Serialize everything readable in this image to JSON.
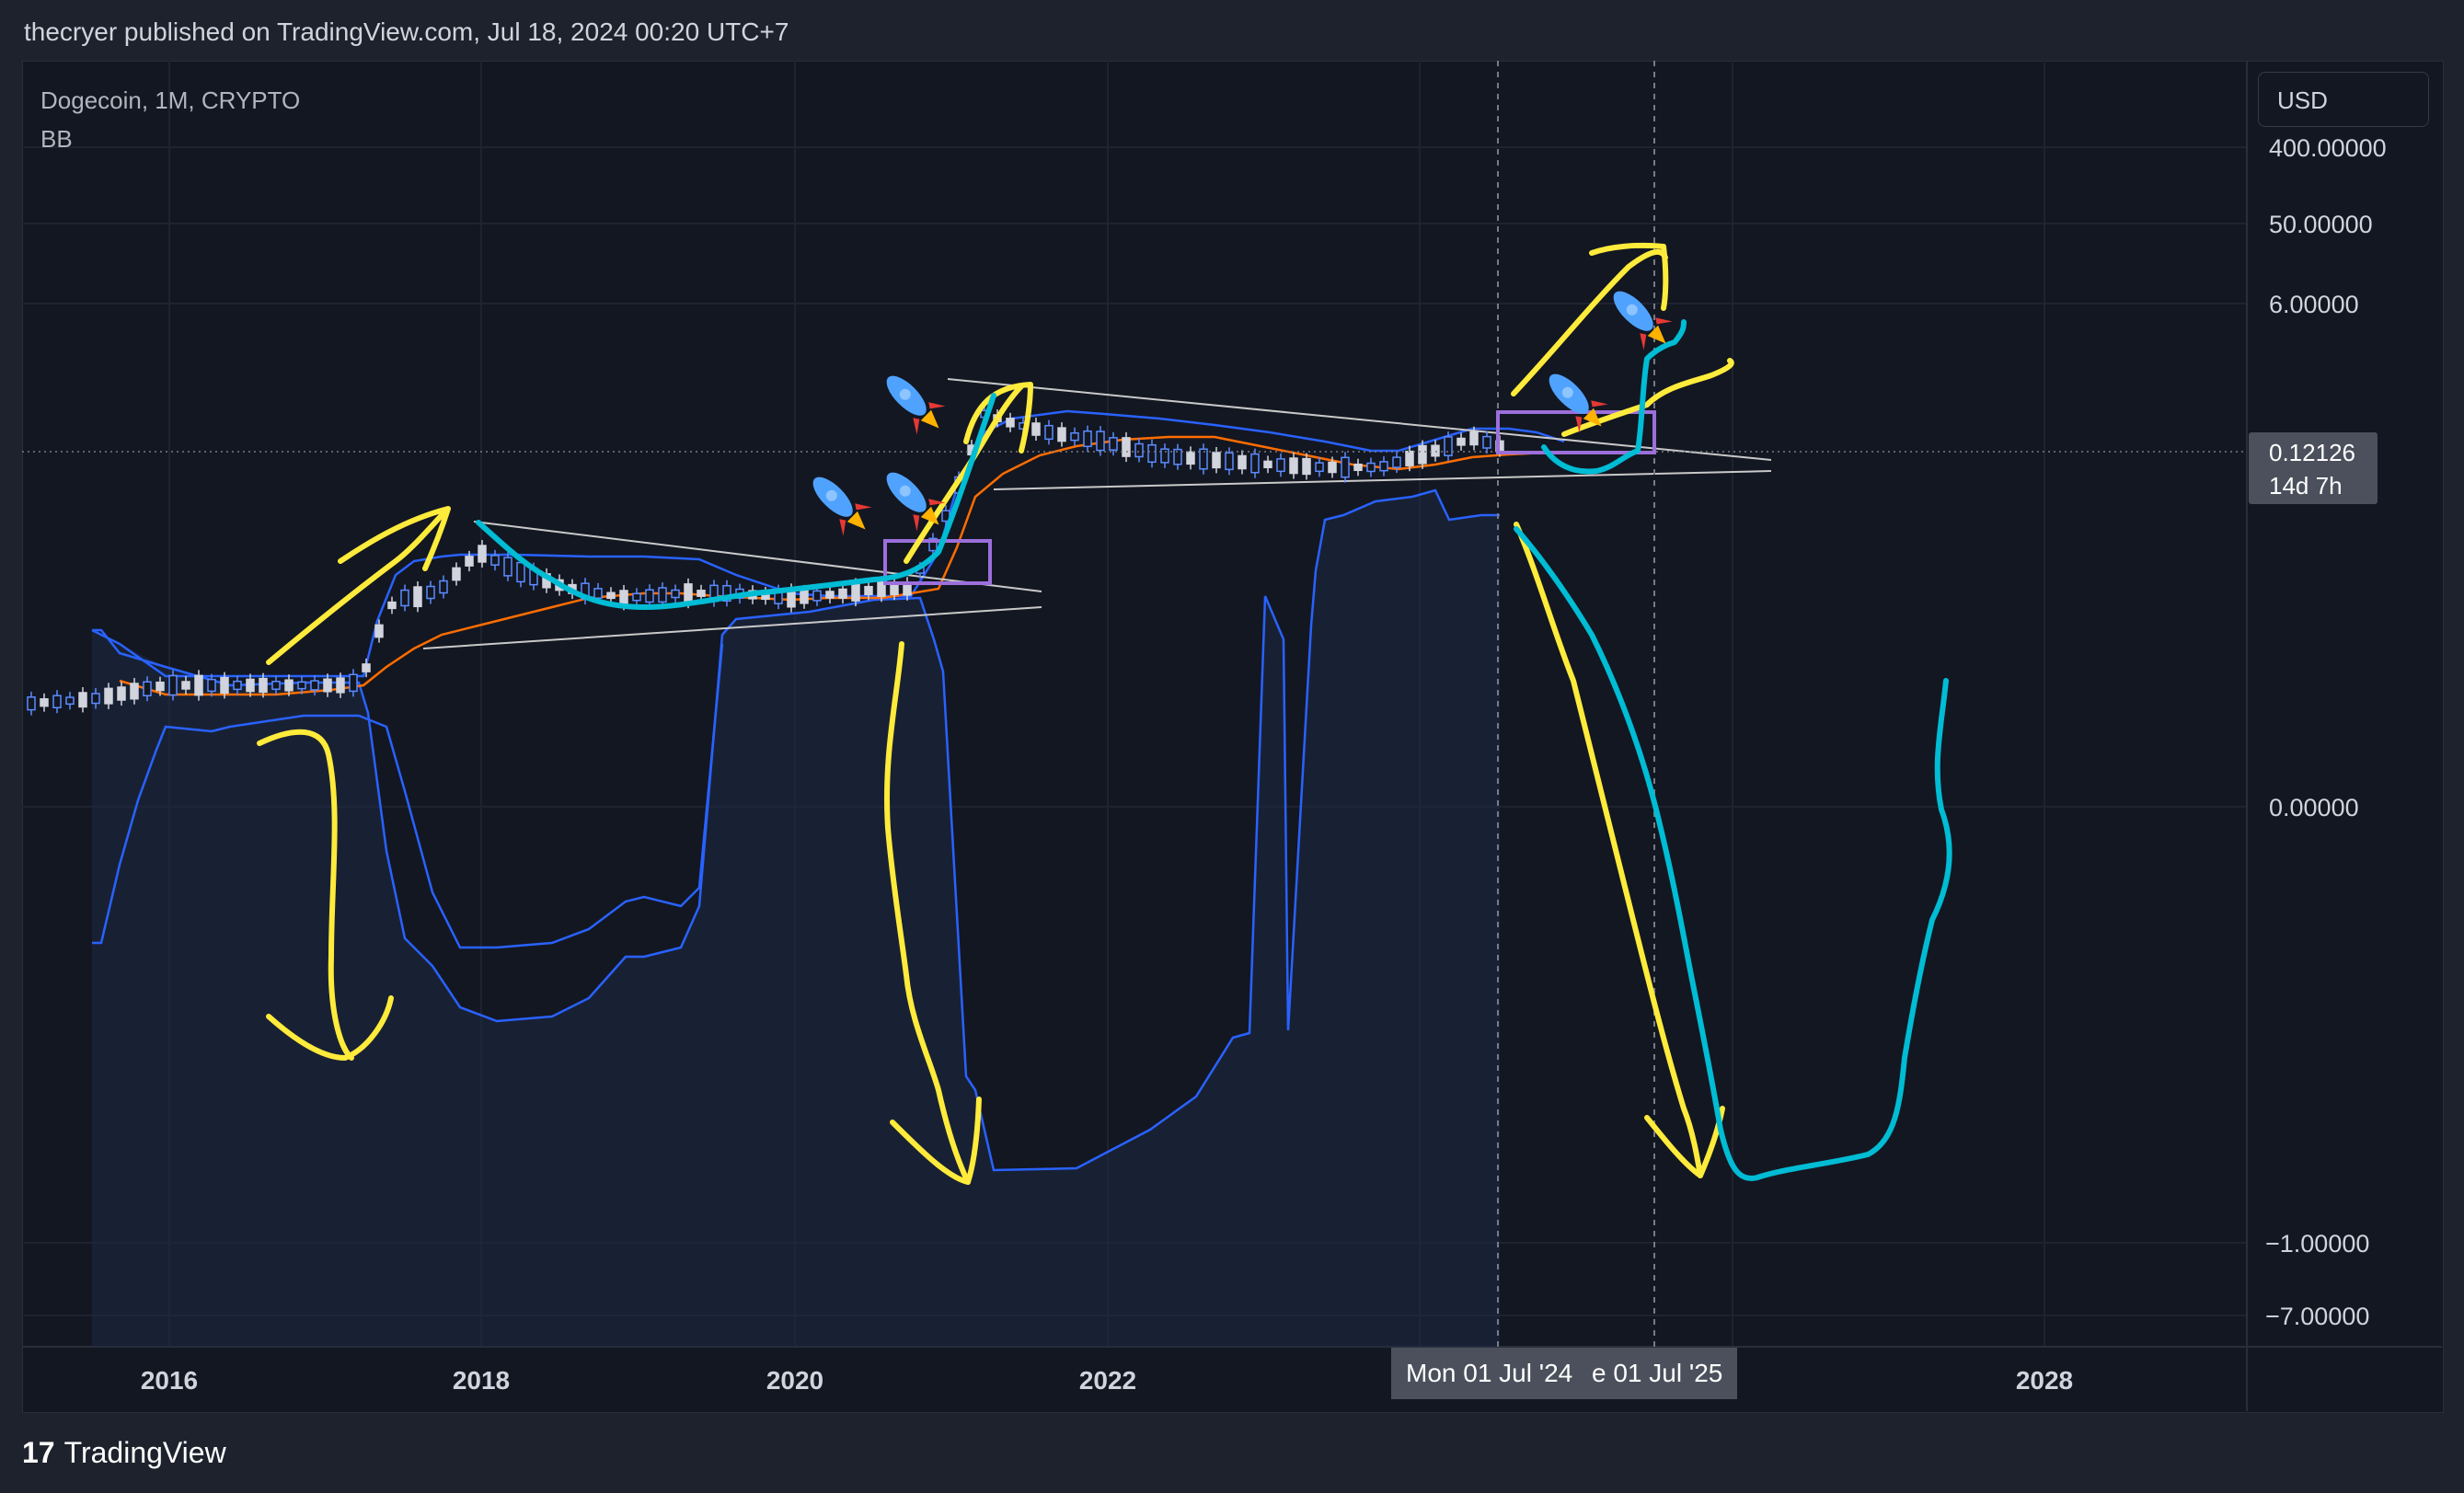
{
  "header": {
    "published": "thecryer published on TradingView.com, Jul 18, 2024 00:20 UTC+7"
  },
  "legend": {
    "symbol": "Dogecoin, 1M, CRYPTO",
    "indicator": "BB"
  },
  "currency": "USD",
  "price": {
    "value": "0.12126",
    "countdown": "14d 7h"
  },
  "crosshair_dates": [
    "Mon 01 Jul '24",
    "e 01 Jul '25"
  ],
  "footer": {
    "brand": "TradingView",
    "logo_glyph": "17"
  },
  "colors": {
    "background": "#131722",
    "upper_band": "#2962ff",
    "basis": "#ff6d00",
    "annotation_yellow": "#ffeb3b",
    "annotation_cyan": "#00bcd4",
    "box": "#9c6fdb"
  },
  "chart_data": {
    "type": "line",
    "x_ticks": [
      "2016",
      "2018",
      "2020",
      "2022",
      "2028"
    ],
    "y_ticks": [
      "400.00000",
      "50.00000",
      "6.00000",
      "0.00000",
      "−1.00000",
      "−7.00000"
    ],
    "y_scale": "log",
    "series": [
      {
        "name": "BB",
        "x": [
          2015.5,
          2016.0,
          2016.5,
          2017.0,
          2017.5,
          2018.0,
          2019.0,
          2020.0,
          2020.8,
          2021.3,
          2021.6,
          2022.0,
          2023.0,
          2024.0,
          2024.5
        ],
        "values": [
          0.0002,
          0.0002,
          0.00025,
          0.0003,
          0.002,
          0.009,
          0.006,
          0.0035,
          0.006,
          0.4,
          0.45,
          0.42,
          0.22,
          0.14,
          0.2
        ]
      }
    ],
    "grid": true
  }
}
